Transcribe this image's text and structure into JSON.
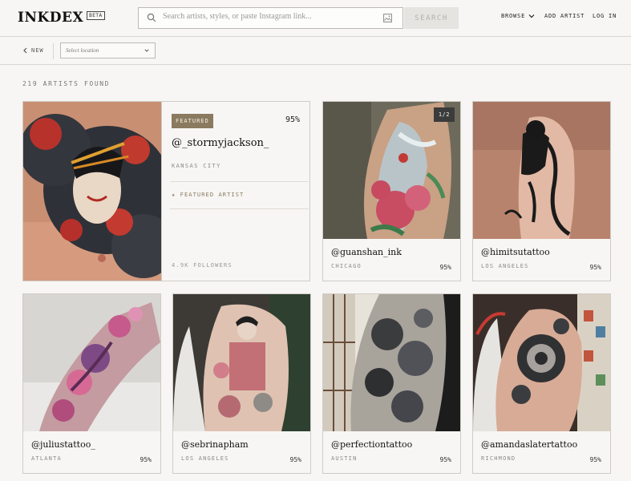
{
  "header": {
    "logo": "INKDEX",
    "beta": "BETA",
    "search_placeholder": "Search artists, styles, or paste Instagram link...",
    "search_button": "SEARCH",
    "nav": {
      "browse": "BROWSE",
      "add_artist": "ADD ARTIST",
      "login": "LOG IN"
    }
  },
  "subbar": {
    "back": "NEW",
    "location_placeholder": "Select location"
  },
  "results": {
    "count_label": "219 ARTISTS FOUND"
  },
  "featured": {
    "badge": "FEATURED",
    "match": "95%",
    "handle": "@_stormyjackson_",
    "city": "KANSAS CITY",
    "featured_label": "★ FEATURED ARTIST",
    "followers": "4.9K FOLLOWERS"
  },
  "artists": [
    {
      "handle": "@guanshan_ink",
      "city": "CHICAGO",
      "match": "95%",
      "pager": "1/2"
    },
    {
      "handle": "@himitsutattoo",
      "city": "LOS ANGELES",
      "match": "95%"
    },
    {
      "handle": "@juliustattoo_",
      "city": "ATLANTA",
      "match": "95%"
    },
    {
      "handle": "@sebrinapham",
      "city": "LOS ANGELES",
      "match": "95%"
    },
    {
      "handle": "@perfectiontattoo",
      "city": "AUSTIN",
      "match": "95%"
    },
    {
      "handle": "@amandaslatertattoo",
      "city": "RICHMOND",
      "match": "95%"
    }
  ],
  "colors": {
    "accent": "#8a7a5f",
    "background": "#f7f6f4",
    "border": "#cfccc7"
  }
}
